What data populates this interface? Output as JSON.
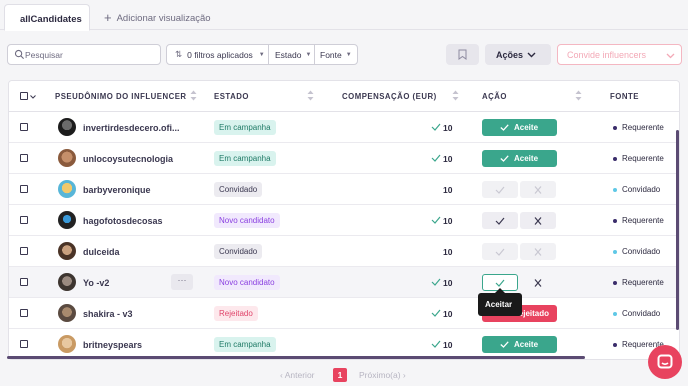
{
  "tabs": {
    "active": "allCandidates",
    "add_label": "Adicionar visualização"
  },
  "toolbar": {
    "search_placeholder": "Pesquisar",
    "filters_label": "0 filtros aplicados",
    "estado_label": "Estado",
    "fonte_label": "Fonte",
    "acoes_label": "Ações",
    "convide_label": "Convide influencers"
  },
  "table": {
    "headers": {
      "pseudonimo": "PSEUDÔNIMO DO INFLUENCER",
      "estado": "ESTADO",
      "compensacao": "COMPENSAÇÃO (EUR)",
      "acao": "AÇÃO",
      "fonte": "FONTE"
    },
    "rows": [
      {
        "name": "invertirdesdecero.ofi...",
        "estado": "Em campanha",
        "comp": "10",
        "comp_check": true,
        "acao": "Aceite",
        "fonte": "Requerente"
      },
      {
        "name": "unlocoysutecnologia",
        "estado": "Em campanha",
        "comp": "10",
        "comp_check": true,
        "acao": "Aceite",
        "fonte": "Requerente"
      },
      {
        "name": "barbyveronique",
        "estado": "Convidado",
        "comp": "10",
        "comp_check": false,
        "acao": "",
        "fonte": "Convidado"
      },
      {
        "name": "hagofotosdecosas",
        "estado": "Novo candidato",
        "comp": "10",
        "comp_check": true,
        "acao": "",
        "fonte": "Requerente"
      },
      {
        "name": "dulceida",
        "estado": "Convidado",
        "comp": "10",
        "comp_check": false,
        "acao": "",
        "fonte": "Convidado"
      },
      {
        "name": "Yo -v2",
        "estado": "Novo candidato",
        "comp": "10",
        "comp_check": true,
        "acao": "",
        "fonte": "Requerente"
      },
      {
        "name": "shakira - v3",
        "estado": "Rejeitado",
        "comp": "10",
        "comp_check": true,
        "acao": "Rejeitado",
        "fonte": "Convidado"
      },
      {
        "name": "britneyspears",
        "estado": "Em campanha",
        "comp": "10",
        "comp_check": true,
        "acao": "Aceite",
        "fonte": "Requerente"
      }
    ],
    "row_more_label": "···"
  },
  "tooltip": "Aceitar",
  "pager": {
    "prev": "Anterior",
    "page": "1",
    "next": "Próximo(a)"
  },
  "colors": {
    "accent_green": "#3aa68c",
    "accent_red": "#e8435f",
    "requerente_dot": "#3b2d6b",
    "convidado_dot": "#5fc8e6"
  }
}
